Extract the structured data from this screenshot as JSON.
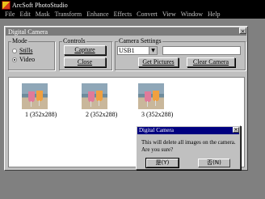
{
  "app": {
    "title": "ArcSoft PhotoStudio",
    "menu": [
      "File",
      "Edit",
      "Mask",
      "Transform",
      "Enhance",
      "Effects",
      "Convert",
      "View",
      "Window",
      "Help"
    ]
  },
  "window": {
    "title": "Digital Camera",
    "close_label": "×",
    "mode": {
      "label": "Mode",
      "options": [
        {
          "label": "Stills",
          "checked": false
        },
        {
          "label": "Video",
          "checked": true
        }
      ]
    },
    "controls": {
      "label": "Controls",
      "capture_label": "Capture",
      "close_label": "Close"
    },
    "camera_settings": {
      "label": "Camera Settings",
      "port_value": "USB1",
      "get_pictures_label": "Get Pictures",
      "clear_camera_label": "Clear Camera"
    },
    "thumbnails": [
      {
        "caption": "1 (352x288)"
      },
      {
        "caption": "2 (352x288)"
      },
      {
        "caption": "3 (352x288)"
      }
    ]
  },
  "dialog": {
    "title": "Digital Camera",
    "close_label": "×",
    "message_line1": "This will delete all images on the camera.",
    "message_line2": "Are you sure?",
    "yes_label": "是(Y)",
    "no_label": "否(N)"
  }
}
